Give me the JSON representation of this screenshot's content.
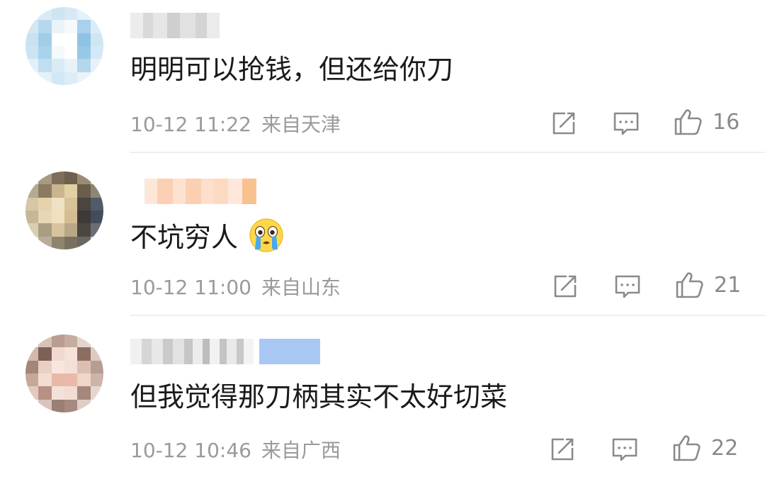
{
  "comments": [
    {
      "text": "明明可以抢钱，但还给你刀",
      "date": "10-12 11:22",
      "location": "来自天津",
      "likes": "16",
      "has_emoji": false
    },
    {
      "text": "不坑穷人",
      "date": "10-12 11:00",
      "location": "来自山东",
      "likes": "21",
      "has_emoji": true,
      "emoji": "crying-face"
    },
    {
      "text": "但我觉得那刀柄其实不太好切菜",
      "date": "10-12 10:46",
      "location": "来自广西",
      "likes": "22",
      "has_emoji": false
    }
  ],
  "colors": {
    "text": "#1a1a1a",
    "meta": "#9a9a9a",
    "icon": "#8a8a8a",
    "divider": "#efefef"
  }
}
